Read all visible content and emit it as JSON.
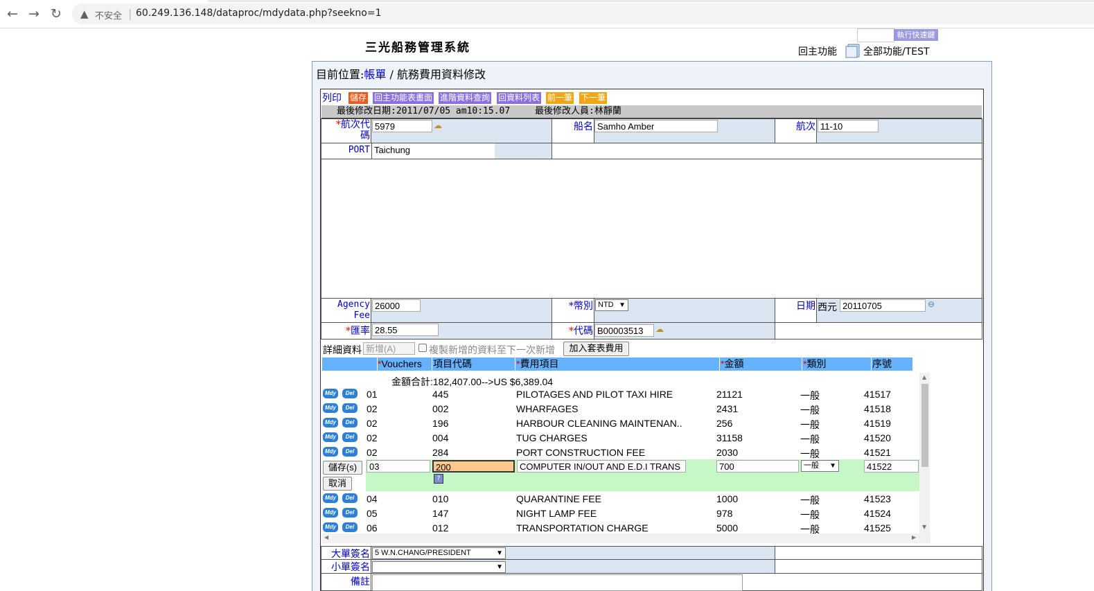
{
  "browser": {
    "insecure_label": "不安全",
    "url": "60.249.136.148/dataproc/mdydata.php?seekno=1"
  },
  "header": {
    "system_title": "三光船務管理系統",
    "quick_key_button": "執行快速鍵",
    "home_link": "回主功能",
    "all_functions_link": "全部功能",
    "user": "/TEST"
  },
  "location": {
    "prefix": "目前位置:",
    "link": "帳單",
    "sep": " / ",
    "page": "航務費用資料修改"
  },
  "toolbar": {
    "print": "列印",
    "save": "儲存",
    "back_main": "回主功能表畫面",
    "advanced_query": "進階資料查詢",
    "back_list": "回資料列表",
    "prev": "前一筆",
    "next": "下一筆"
  },
  "info": {
    "modified_date": "最後修改日期:2011/07/05 am10:15.07",
    "modified_by": "最後修改人員:林靜蘭"
  },
  "form": {
    "voyage_code_label": "*航次代碼",
    "voyage_code": "5979",
    "ship_name_label": "船名",
    "ship_name": "Samho Amber",
    "voyage_label": "航次",
    "voyage": "11-10",
    "port_label": "PORT",
    "port": "Taichung",
    "agency_fee_label": "Agency Fee",
    "agency_fee": "26000",
    "currency_label": "*幣別",
    "currency": "NTD",
    "date_label": "日期",
    "date_era": "西元",
    "date": "20110705",
    "rate_label": "*匯率",
    "rate": "28.55",
    "code_label": "*代碼",
    "code": "B00003513",
    "big_sign_label": "大單簽名",
    "big_sign": "5 W.N.CHANG/PRESIDENT",
    "small_sign_label": "小單簽名",
    "small_sign": "",
    "remark_label": "備註"
  },
  "detail": {
    "label": "詳細資料",
    "add_button": "新增(A)",
    "copy_checkbox": "複製新增的資料至下一次新增",
    "add_template_button": "加入套表費用",
    "headers": [
      "*Vouchers",
      "項目代碼",
      "*費用項目",
      "*金額",
      "*類別",
      "序號"
    ],
    "total": "金額合計:182,407.00-->US $6,389.04",
    "mdy": "Mdy",
    "del": "Del",
    "rows_before": [
      {
        "voucher": "01",
        "code": "445",
        "item": "PILOTAGES AND PILOT TAXI HIRE",
        "amount": "21121",
        "type": "一般",
        "seq": "41517"
      },
      {
        "voucher": "02",
        "code": "002",
        "item": "WHARFAGES",
        "amount": "2431",
        "type": "一般",
        "seq": "41518"
      },
      {
        "voucher": "02",
        "code": "196",
        "item": "HARBOUR CLEANING MAINTENAN..",
        "amount": "256",
        "type": "一般",
        "seq": "41519"
      },
      {
        "voucher": "02",
        "code": "004",
        "item": "TUG CHARGES",
        "amount": "31158",
        "type": "一般",
        "seq": "41520"
      },
      {
        "voucher": "02",
        "code": "284",
        "item": "PORT CONSTRUCTION FEE",
        "amount": "2030",
        "type": "一般",
        "seq": "41521"
      }
    ],
    "edit": {
      "save_button": "儲存(s)",
      "cancel_button": "取消",
      "voucher": "03",
      "code": "200",
      "item": "COMPUTER IN/OUT AND E.D.I TRANS",
      "amount": "700",
      "type": "一般",
      "seq": "41522"
    },
    "rows_after": [
      {
        "voucher": "04",
        "code": "010",
        "item": "QUARANTINE FEE",
        "amount": "1000",
        "type": "一般",
        "seq": "41523"
      },
      {
        "voucher": "05",
        "code": "147",
        "item": "NIGHT LAMP FEE",
        "amount": "978",
        "type": "一般",
        "seq": "41524"
      },
      {
        "voucher": "06",
        "code": "012",
        "item": "TRANSPORTATION CHARGE",
        "amount": "5000",
        "type": "一般",
        "seq": "41525"
      }
    ]
  }
}
